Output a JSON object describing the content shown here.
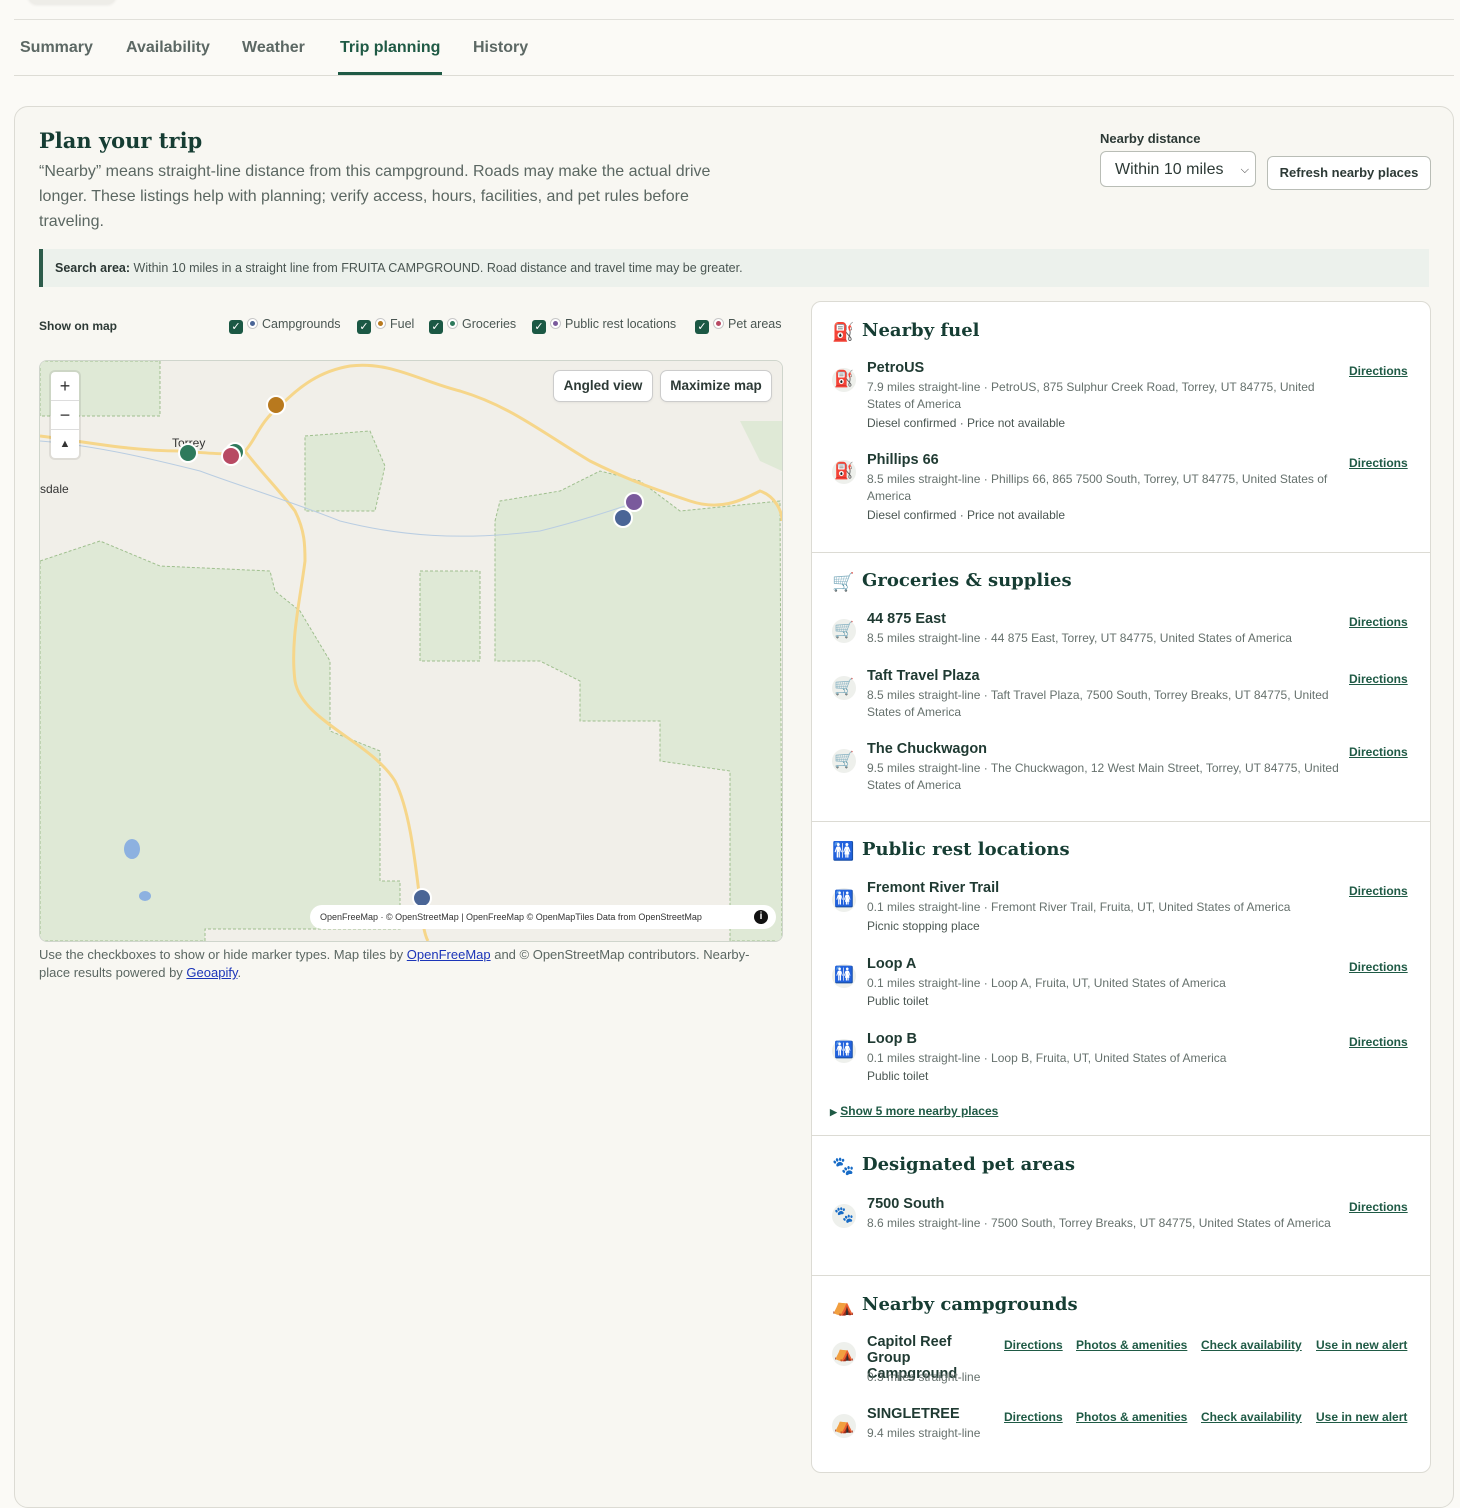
{
  "tabs": [
    {
      "label": "Summary"
    },
    {
      "label": "Availability"
    },
    {
      "label": "Weather"
    },
    {
      "label": "Trip planning"
    },
    {
      "label": "History"
    }
  ],
  "plan": {
    "title": "Plan your trip",
    "intro": "“Nearby” means straight-line distance from this campground. Roads may make the actual drive longer. These listings help with planning; verify access, hours, facilities, and pet rules before traveling.",
    "nearby_distance_label": "Nearby distance",
    "nearby_distance_value": "Within 10 miles",
    "refresh_label": "Refresh nearby places",
    "search_area_label": "Search area:",
    "search_area_text": "Within 10 miles in a straight line from FRUITA CAMPGROUND. Road distance and travel time may be greater."
  },
  "map_filters": {
    "label": "Show on map",
    "items": [
      {
        "label": "Campgrounds",
        "color": "#4a6596"
      },
      {
        "label": "Fuel",
        "color": "#b8791e"
      },
      {
        "label": "Groceries",
        "color": "#2e7a5c"
      },
      {
        "label": "Public rest locations",
        "color": "#7a5a9c"
      },
      {
        "label": "Pet areas",
        "color": "#b84a63"
      }
    ]
  },
  "map": {
    "angled_view": "Angled view",
    "maximize": "Maximize map",
    "zoom_in": "+",
    "zoom_out": "−",
    "compass": "▲",
    "place_label_torrey": "Torrey",
    "place_label_sdale": "sdale",
    "attribution": "OpenFreeMap · © OpenStreetMap | OpenFreeMap © OpenMapTiles Data from OpenStreetMap",
    "note_before": "Use the checkboxes to show or hide marker types. Map tiles by ",
    "note_link1": "OpenFreeMap",
    "note_middle": " and © OpenStreetMap contributors. Nearby-place results powered by ",
    "note_link2": "Geoapify",
    "note_after": "."
  },
  "fuel": {
    "title": "Nearby fuel",
    "items": [
      {
        "name": "PetroUS",
        "desc": "7.9 miles straight-line · PetroUS, 875 Sulphur Creek Road, Torrey, UT 84775, United States of America",
        "extra": "Diesel confirmed · Price not available",
        "action": "Directions"
      },
      {
        "name": "Phillips 66",
        "desc": "8.5 miles straight-line · Phillips 66, 865 7500 South, Torrey, UT 84775, United States of America",
        "extra": "Diesel confirmed · Price not available",
        "action": "Directions"
      }
    ]
  },
  "groceries": {
    "title": "Groceries & supplies",
    "items": [
      {
        "name": "44 875 East",
        "desc": "8.5 miles straight-line · 44 875 East, Torrey, UT 84775, United States of America",
        "action": "Directions"
      },
      {
        "name": "Taft Travel Plaza",
        "desc": "8.5 miles straight-line · Taft Travel Plaza, 7500 South, Torrey Breaks, UT 84775, United States of America",
        "action": "Directions"
      },
      {
        "name": "The Chuckwagon",
        "desc": "9.5 miles straight-line · The Chuckwagon, 12 West Main Street, Torrey, UT 84775, United States of America",
        "action": "Directions"
      }
    ]
  },
  "rest": {
    "title": "Public rest locations",
    "items": [
      {
        "name": "Fremont River Trail",
        "desc": "0.1 miles straight-line · Fremont River Trail, Fruita, UT, United States of America",
        "extra": "Picnic stopping place",
        "action": "Directions"
      },
      {
        "name": "Loop A",
        "desc": "0.1 miles straight-line · Loop A, Fruita, UT, United States of America",
        "extra": "Public toilet",
        "action": "Directions"
      },
      {
        "name": "Loop B",
        "desc": "0.1 miles straight-line · Loop B, Fruita, UT, United States of America",
        "extra": "Public toilet",
        "action": "Directions"
      }
    ],
    "show_more": "Show 5 more nearby places"
  },
  "pets": {
    "title": "Designated pet areas",
    "items": [
      {
        "name": "7500 South",
        "desc": "8.6 miles straight-line · 7500 South, Torrey Breaks, UT 84775, United States of America",
        "action": "Directions"
      }
    ]
  },
  "campgrounds": {
    "title": "Nearby campgrounds",
    "items": [
      {
        "name": "Capitol Reef Group Campground",
        "desc": "0.3 miles straight-line"
      },
      {
        "name": "SINGLETREE",
        "desc": "9.4 miles straight-line"
      }
    ],
    "links": {
      "directions": "Directions",
      "photos": "Photos & amenities",
      "availability": "Check availability",
      "alert": "Use in new alert"
    }
  }
}
